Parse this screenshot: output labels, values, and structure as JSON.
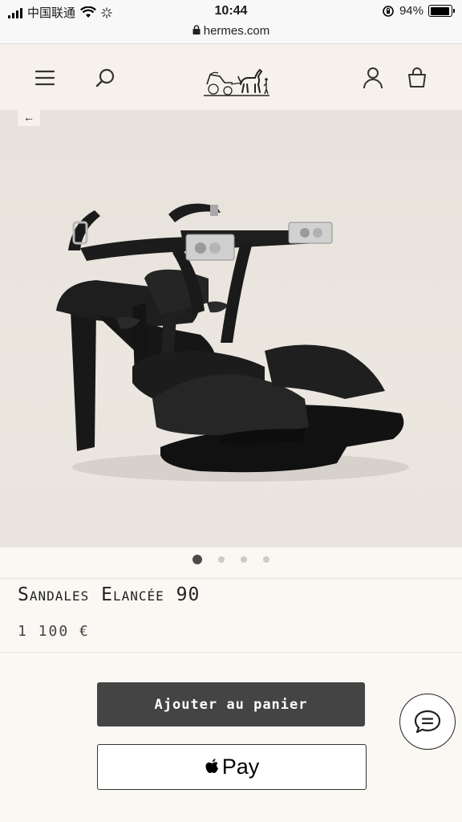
{
  "status_bar": {
    "carrier": "中国联通",
    "time": "10:44",
    "battery": "94%"
  },
  "url_bar": {
    "domain": "hermes.com"
  },
  "header": {
    "menu_icon": "hamburger-icon",
    "search_icon": "search-icon",
    "logo": "hermes-carriage-logo",
    "account_icon": "user-icon",
    "bag_icon": "shopping-bag-icon"
  },
  "gallery": {
    "back_label": "←",
    "current_index": 1,
    "total_images": 4
  },
  "product": {
    "name": "Sandales Elancée 90",
    "price": "1 100 €"
  },
  "actions": {
    "add_to_cart": "Ajouter au panier",
    "apple_pay": "Pay"
  },
  "colors": {
    "header_bg": "#f6f1eb",
    "page_bg": "#fbf8f4",
    "primary_button": "#444444"
  }
}
